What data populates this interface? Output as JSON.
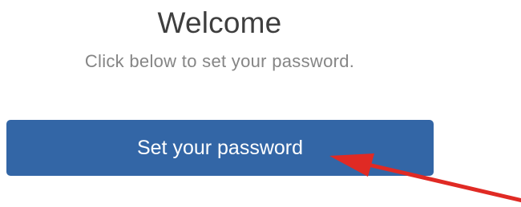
{
  "welcome": {
    "title": "Welcome",
    "subtitle": "Click below to set your password.",
    "button_label": "Set your password"
  },
  "colors": {
    "button_background": "#3366a6",
    "button_text": "#ffffff",
    "title_text": "#3e3e3e",
    "subtitle_text": "#858585",
    "annotation_arrow": "#e02a24"
  },
  "icons": {
    "annotation": "red-arrow-icon"
  }
}
